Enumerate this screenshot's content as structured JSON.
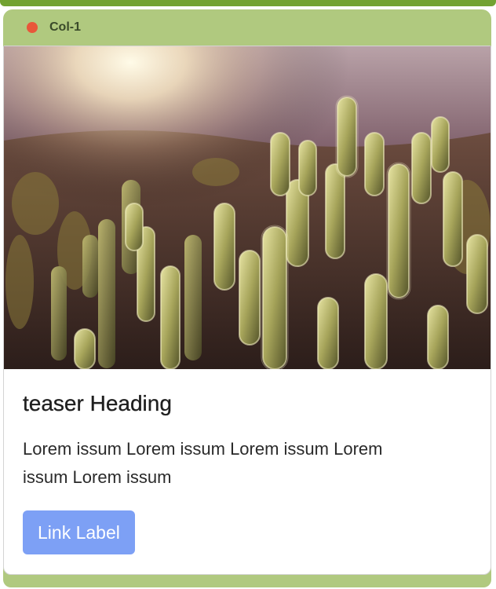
{
  "column": {
    "title": "Col-1",
    "status_color": "#e8573a",
    "accent_color": "#b0c97f"
  },
  "teaser": {
    "image_subject": "cactus-image",
    "heading": "teaser Heading",
    "body": "Lorem issum Lorem issum Lorem issum Lorem issum Lorem issum",
    "link_label": "Link Label",
    "link_color": "#7da0f5"
  }
}
